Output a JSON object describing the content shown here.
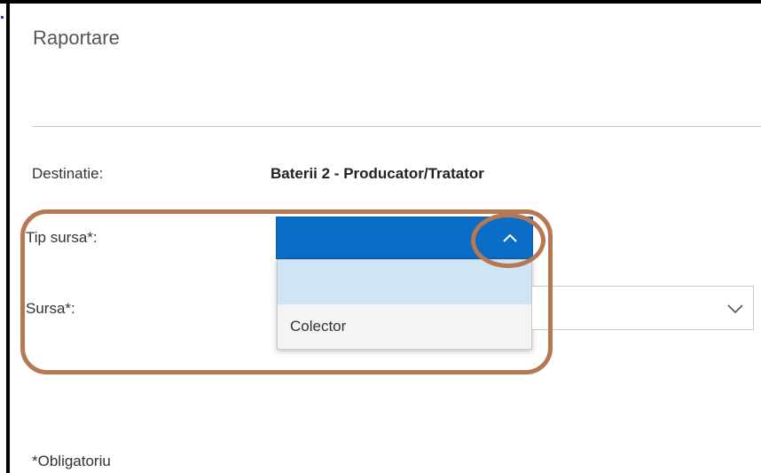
{
  "header": {
    "title": "Raportare"
  },
  "form": {
    "destinatie_label": "Destinatie:",
    "destinatie_value": "Baterii 2 - Producator/Tratator",
    "tip_sursa_label": "Tip sursa*:",
    "tip_sursa_selected": "",
    "tip_sursa_options": [
      "",
      "Colector"
    ],
    "sursa_label": "Sursa*:",
    "sursa_selected": ""
  },
  "footer": {
    "required_note": "*Obligatoriu"
  },
  "colors": {
    "accent": "#0b6dc6",
    "highlight": "#cfe4f6",
    "annotation": "#b57853"
  }
}
